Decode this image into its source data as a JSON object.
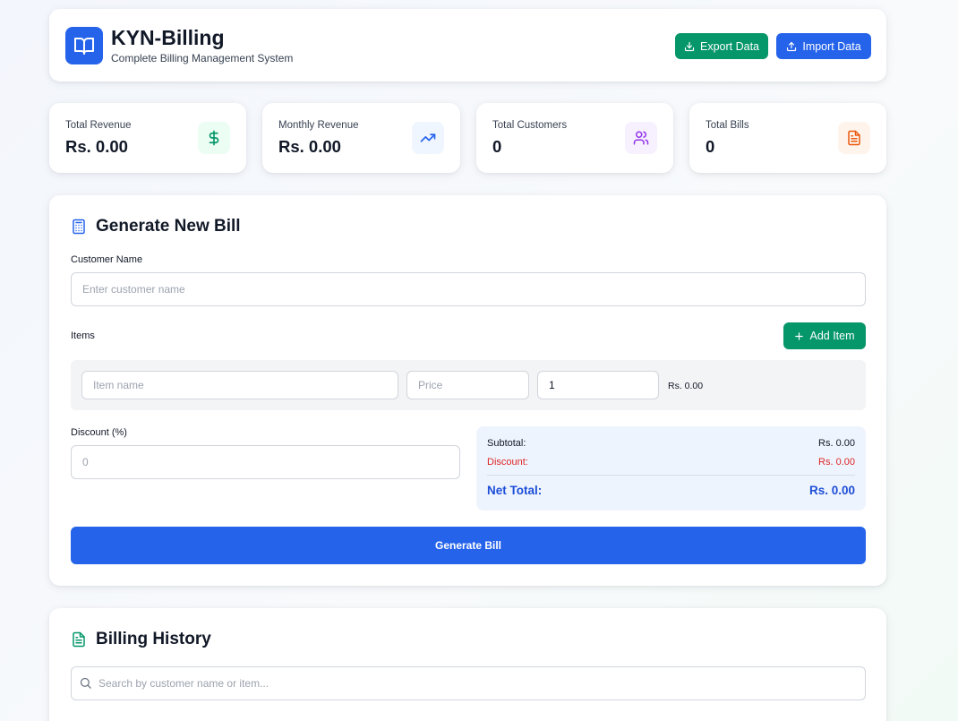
{
  "header": {
    "title": "KYN-Billing",
    "subtitle": "Complete Billing Management System",
    "logo_icon": "book-open-icon",
    "export_label": "Export Data",
    "import_label": "Import Data"
  },
  "stats": [
    {
      "label": "Total Revenue",
      "value": "Rs. 0.00",
      "icon": "dollar-icon",
      "icon_color": "#059669",
      "bg": "#ecfdf3"
    },
    {
      "label": "Monthly Revenue",
      "value": "Rs. 0.00",
      "icon": "trending-up-icon",
      "icon_color": "#2563eb",
      "bg": "#eff6ff"
    },
    {
      "label": "Total Customers",
      "value": "0",
      "icon": "users-icon",
      "icon_color": "#9333ea",
      "bg": "#f7f0ff"
    },
    {
      "label": "Total Bills",
      "value": "0",
      "icon": "file-text-icon",
      "icon_color": "#ea580c",
      "bg": "#fff4ec"
    }
  ],
  "generate": {
    "title": "Generate New Bill",
    "customer_label": "Customer Name",
    "customer_placeholder": "Enter customer name",
    "customer_value": "",
    "items_label": "Items",
    "add_item_label": "Add Item",
    "item": {
      "name_placeholder": "Item name",
      "price_placeholder": "Price",
      "quantity_value": "1",
      "line_total": "Rs. 0.00"
    },
    "discount_label": "Discount (%)",
    "discount_placeholder": "0",
    "summary": {
      "subtotal_label": "Subtotal:",
      "subtotal_value": "Rs. 0.00",
      "discount_label": "Discount:",
      "discount_value": "Rs. 0.00",
      "net_label": "Net Total:",
      "net_value": "Rs. 0.00"
    },
    "submit_label": "Generate Bill"
  },
  "history": {
    "title": "Billing History",
    "search_placeholder": "Search by customer name or item..."
  },
  "colors": {
    "primary": "#2563eb",
    "success": "#059669",
    "danger": "#dc2626"
  }
}
